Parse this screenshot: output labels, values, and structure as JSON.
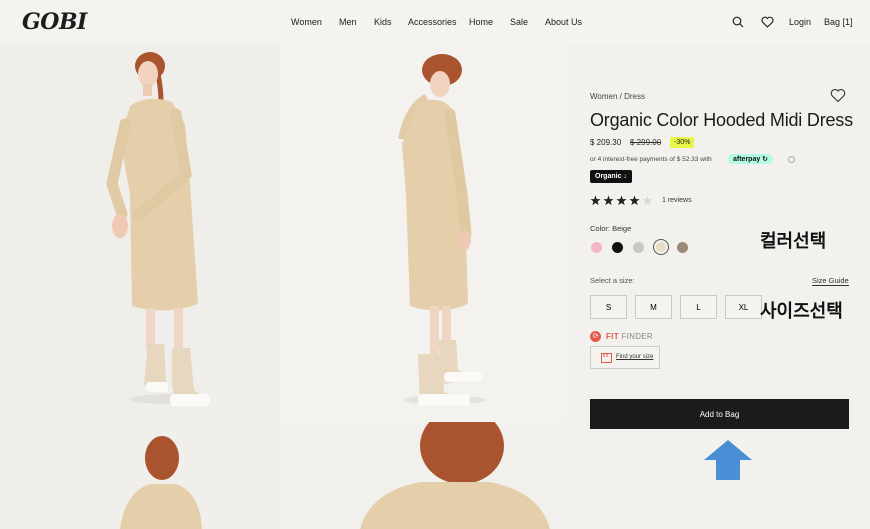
{
  "brand": {
    "logo": "GOBI"
  },
  "nav": [
    "Women",
    "Men",
    "Kids",
    "Accessories",
    "Home",
    "Sale",
    "About Us"
  ],
  "utility": {
    "login": "Login",
    "bag": "Bag [1]"
  },
  "product": {
    "breadcrumb": "Women / Dress",
    "title": "Organic Color Hooded Midi Dress",
    "price": "$ 209.30",
    "price_old": "$ 299.00",
    "discount": "-30%",
    "installments": "or 4 interest-free payments of $ 52.33 with",
    "afterpay": "afterpay",
    "badge": "Organic",
    "rating": 4,
    "reviews": "1 reviews",
    "color_label": "Color: Beige",
    "colors": [
      "#f2b8c2",
      "#111111",
      "#c8c8c8",
      "#e8dcc6",
      "#9a8b79"
    ],
    "selected_color_index": 3,
    "size_label": "Select a size:",
    "size_guide": "Size Guide",
    "sizes": [
      "S",
      "M",
      "L",
      "XL"
    ],
    "fit_finder": {
      "brand": "FIT",
      "rest": "FINDER"
    },
    "find_your_size": "Find your size",
    "add_to_bag": "Add to Bag"
  },
  "annotations": {
    "color_select": "컬러선택",
    "size_select": "사이즈선택"
  },
  "theme": {
    "accent_afterpay": "#b2fce4",
    "discount_bg": "#e9f74a",
    "arrow": "#4a8fd6"
  }
}
